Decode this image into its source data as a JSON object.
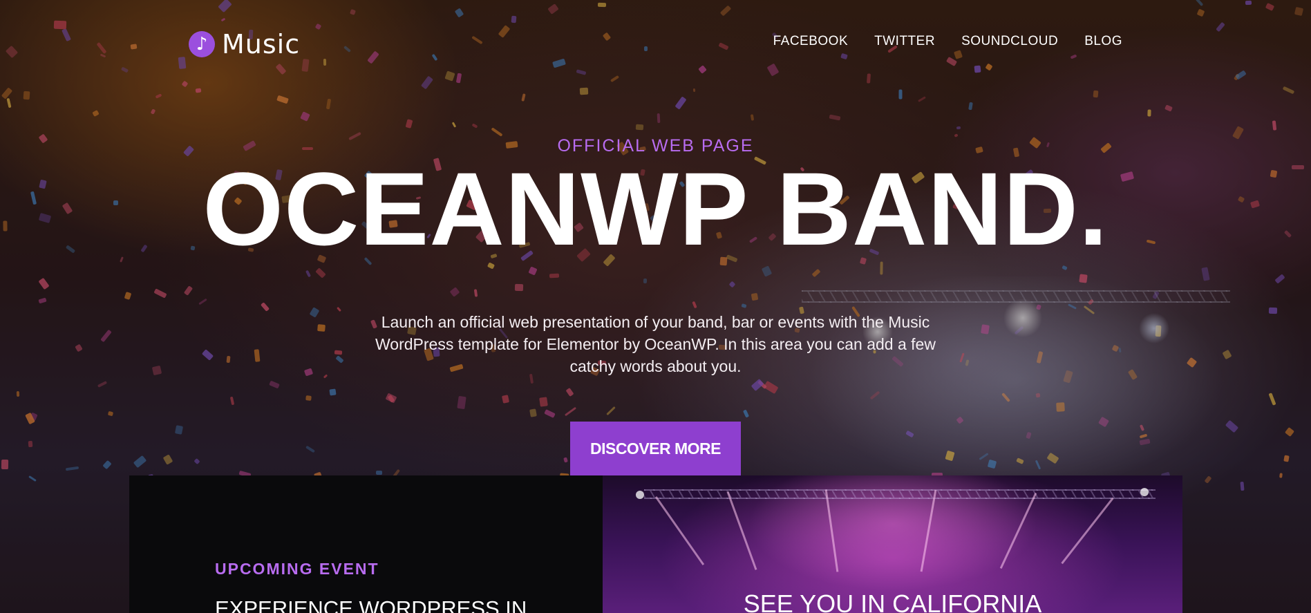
{
  "header": {
    "logo_text": "Music",
    "logo_icon": "music-note-icon",
    "nav": [
      {
        "label": "FACEBOOK"
      },
      {
        "label": "TWITTER"
      },
      {
        "label": "SOUNDCLOUD"
      },
      {
        "label": "BLOG"
      }
    ]
  },
  "hero": {
    "kicker": "OFFICIAL WEB PAGE",
    "title": "OCEANWP BAND.",
    "description": "Launch an official web presentation of your band, bar or events with the Music WordPress template for Elementor by OceanWP. In this area you can add a few catchy words about you.",
    "cta_label": "DISCOVER MORE"
  },
  "event_panel": {
    "label": "UPCOMING EVENT",
    "title": "EXPERIENCE WORDPRESS IN"
  },
  "image_panel": {
    "title": "SEE YOU IN CALIFORNIA"
  },
  "colors": {
    "accent": "#8e3fcf",
    "accent_text": "#b86cf0",
    "panel_dark": "#0a0a0c"
  }
}
